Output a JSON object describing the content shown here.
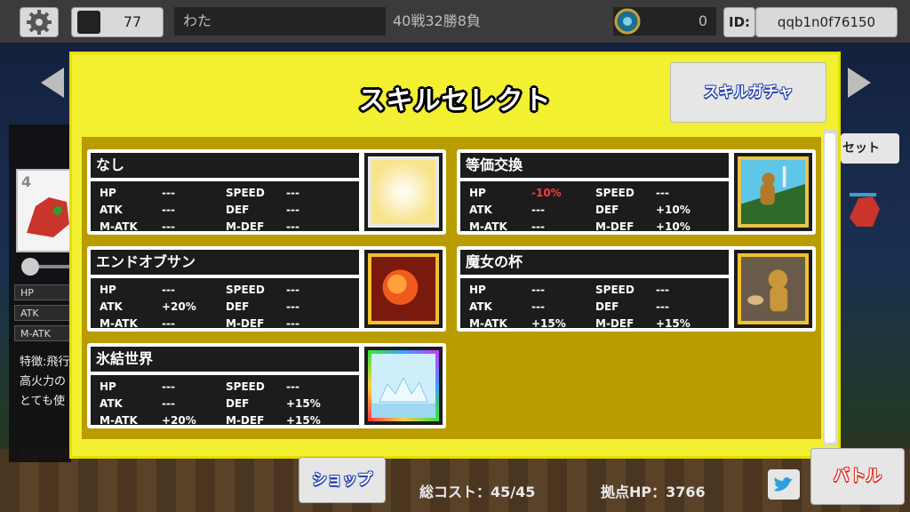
{
  "topbar": {
    "gem_count": "77",
    "player_name": "わた",
    "record": "40戦32勝8負",
    "coin_count": "0",
    "id_label": "ID:",
    "id_value": "qqb1n0f76150"
  },
  "left_panel": {
    "stats": [
      "HP",
      "ATK",
      "M-ATK"
    ],
    "desc_lines": [
      "特徴:飛行",
      "高火力の",
      "とても使"
    ]
  },
  "right_panel": {
    "reset_label": "セット"
  },
  "modal": {
    "title": "スキルセレクト",
    "gacha_label": "スキルガチャ"
  },
  "skills": [
    {
      "name": "なし",
      "hp": "---",
      "atk": "---",
      "matk": "---",
      "speed": "---",
      "def": "---",
      "mdef": "---",
      "icon": "blank-icon"
    },
    {
      "name": "等価交換",
      "hp": "-10%",
      "atk": "---",
      "matk": "---",
      "speed": "---",
      "def": "+10%",
      "mdef": "+10%",
      "icon": "cookie-man-icon"
    },
    {
      "name": "エンドオブサン",
      "hp": "---",
      "atk": "+20%",
      "matk": "---",
      "speed": "---",
      "def": "---",
      "mdef": "---",
      "icon": "fireball-icon"
    },
    {
      "name": "魔女の杯",
      "hp": "---",
      "atk": "---",
      "matk": "+15%",
      "speed": "---",
      "def": "---",
      "mdef": "+15%",
      "icon": "witch-cup-icon"
    },
    {
      "name": "氷結世界",
      "hp": "---",
      "atk": "---",
      "matk": "+20%",
      "speed": "---",
      "def": "+15%",
      "mdef": "+15%",
      "icon": "ice-world-icon"
    }
  ],
  "stat_labels": {
    "hp": "HP",
    "atk": "ATK",
    "matk": "M-ATK",
    "speed": "SPEED",
    "def": "DEF",
    "mdef": "M-DEF"
  },
  "bottom": {
    "shop_label": "ショップ",
    "cost_text": "総コスト：45/45",
    "base_hp_text": "拠点HP：3766",
    "battle_label": "バトル"
  },
  "colors": {
    "modal_bg": "#f3f031",
    "list_bg": "#b89c00",
    "negative": "#ff3b3b",
    "battle_red": "#d8261c"
  }
}
